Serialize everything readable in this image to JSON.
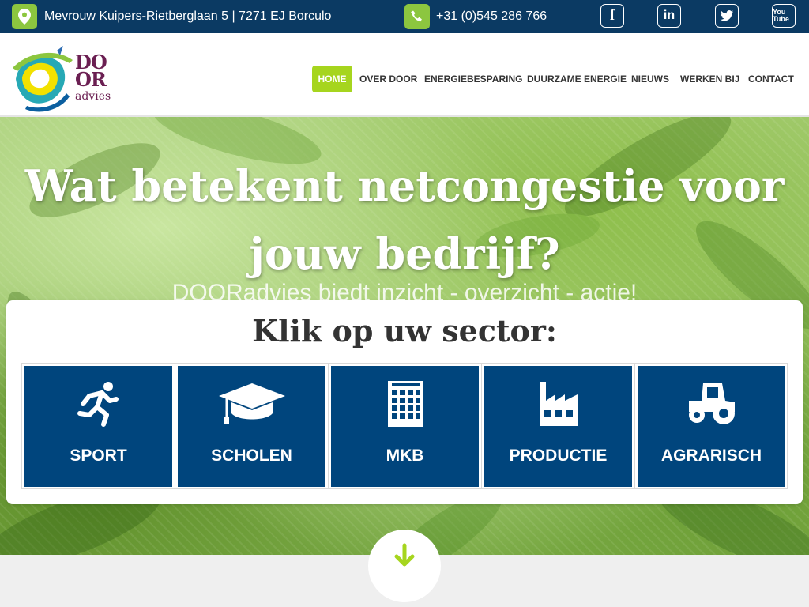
{
  "topbar": {
    "address": "Mevrouw Kuipers-Rietberglaan 5 | 7271 EJ Borculo",
    "phone": "+31 (0)545 286 766",
    "address_icon": "map-pin-icon",
    "phone_icon": "phone-icon",
    "social": [
      {
        "name": "facebook-icon",
        "glyph": "f"
      },
      {
        "name": "linkedin-icon",
        "glyph": "in"
      },
      {
        "name": "twitter-icon",
        "glyph": "t"
      },
      {
        "name": "youtube-icon",
        "glyph": "You Tube"
      }
    ]
  },
  "logo": {
    "line1": "DO",
    "line2": "OR",
    "line3": "advies"
  },
  "nav": {
    "items": [
      "HOME",
      "OVER DOOR",
      "ENERGIEBESPARING",
      "DUURZAME ENERGIE",
      "NIEUWS",
      "WERKEN BIJ",
      "CONTACT"
    ],
    "active": "HOME"
  },
  "hero": {
    "title": "Wat betekent netcongestie voor jouw bedrijf?",
    "subtitle": "DOORadvies biedt inzicht - overzicht - actie!"
  },
  "sectors": {
    "title": "Klik op uw sector:",
    "items": [
      {
        "label": "SPORT",
        "icon": "running-person-icon"
      },
      {
        "label": "SCHOLEN",
        "icon": "graduation-cap-icon"
      },
      {
        "label": "MKB",
        "icon": "office-building-icon"
      },
      {
        "label": "PRODUCTIE",
        "icon": "factory-icon"
      },
      {
        "label": "AGRARISCH",
        "icon": "tractor-icon"
      }
    ]
  },
  "colors": {
    "topbar_bg": "#0b3a63",
    "accent_green": "#a6d51e",
    "tile_blue": "#00457d",
    "logo_purple": "#6b1f52"
  },
  "scroll": {
    "icon": "arrow-down-icon"
  }
}
